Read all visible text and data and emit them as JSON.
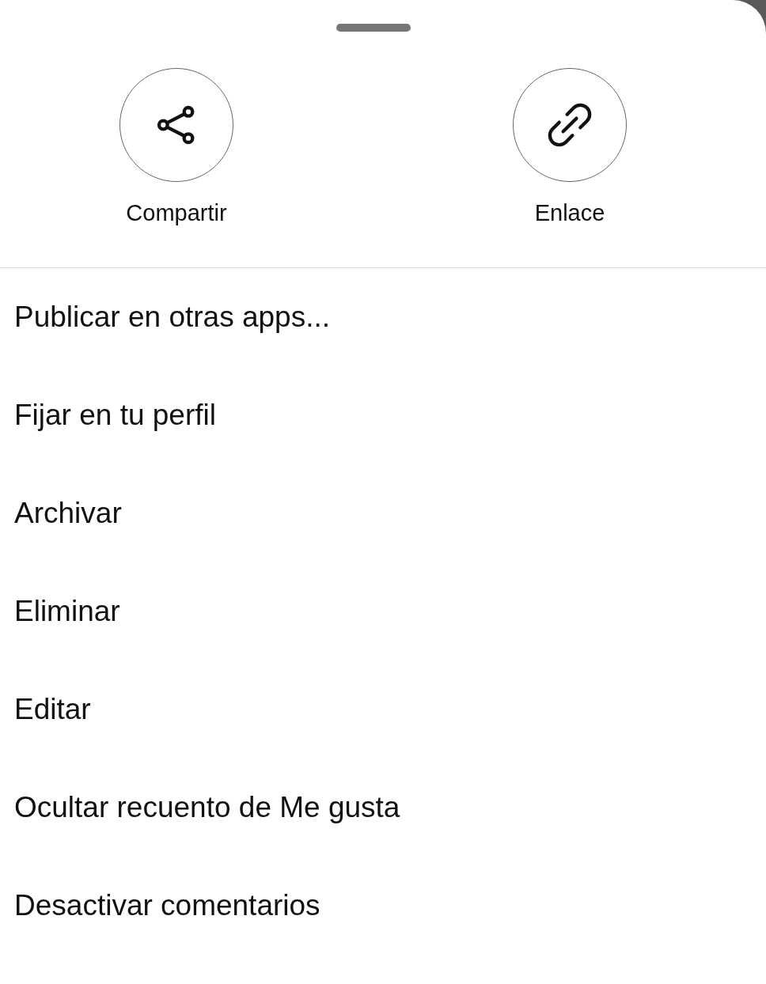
{
  "actions": [
    {
      "kind": "share",
      "label": "Compartir"
    },
    {
      "kind": "link",
      "label": "Enlace"
    }
  ],
  "menu_items": [
    "Publicar en otras apps...",
    "Fijar en tu perfil",
    "Archivar",
    "Eliminar",
    "Editar",
    "Ocultar recuento de Me gusta",
    "Desactivar comentarios"
  ]
}
